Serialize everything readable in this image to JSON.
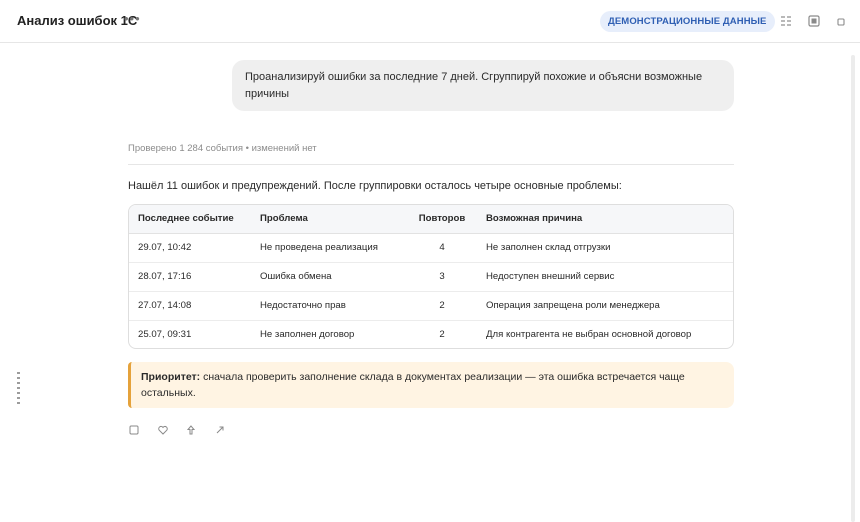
{
  "header": {
    "title": "Анализ ошибок 1С",
    "more_glyph": "•••",
    "badge": "ДЕМОНСТРАЦИОННЫЕ ДАННЫЕ",
    "icons": [
      "grid-icon",
      "panel-icon",
      "square-icon"
    ]
  },
  "chat": {
    "user_message": "Проанализируй ошибки за последние 7 дней. Сгруппируй похожие и объясни возможные причины",
    "checked_note": "Проверено 1 284 события • изменений нет",
    "intro": "Нашёл 11 ошибок и предупреждений. После группировки осталось четыре основные проблемы:",
    "table": {
      "headers": [
        "Последнее событие",
        "Проблема",
        "Повторов",
        "Возможная причина"
      ],
      "rows": [
        [
          "29.07, 10:42",
          "Не проведена реализация",
          "4",
          "Не заполнен склад отгрузки"
        ],
        [
          "28.07, 17:16",
          "Ошибка обмена",
          "3",
          "Недоступен внешний сервис"
        ],
        [
          "27.07, 14:08",
          "Недостаточно прав",
          "2",
          "Операция запрещена роли менеджера"
        ],
        [
          "25.07, 09:31",
          "Не заполнен договор",
          "2",
          "Для контрагента не выбран основной договор"
        ]
      ]
    },
    "priority": {
      "label": "Приоритет:",
      "text": "сначала проверить заполнение склада в документах реализации — эта ошибка встречается чаще остальных."
    },
    "actions": [
      "copy-icon",
      "like-icon",
      "dislike-icon",
      "share-icon"
    ]
  },
  "colors": {
    "badge_bg": "#e7eefb",
    "badge_text": "#2f5fb3",
    "priority_bg": "#fff4e3",
    "priority_border": "#e5a23b",
    "bubble_bg": "#efefef"
  }
}
